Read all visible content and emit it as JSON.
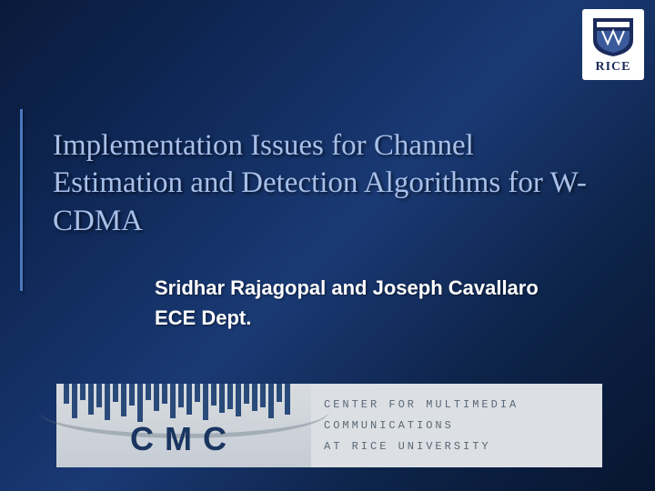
{
  "corner_logo": {
    "institution": "RICE"
  },
  "title": "Implementation Issues for  Channel Estimation and Detection Algorithms for W-CDMA",
  "authors": "Sridhar Rajagopal and Joseph Cavallaro",
  "department": "ECE Dept.",
  "footer_logo": {
    "acronym": "CMC",
    "line1": "CENTER FOR MULTIMEDIA",
    "line2": "COMMUNICATIONS",
    "line3": "AT RICE UNIVERSITY"
  }
}
